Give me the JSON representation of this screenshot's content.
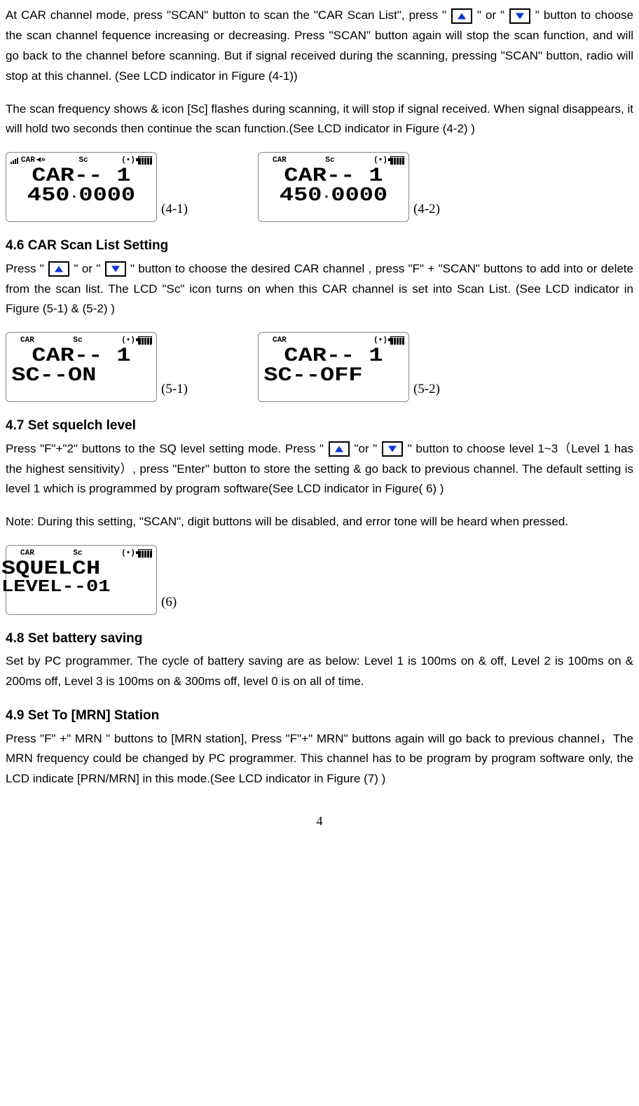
{
  "p1a": "At CAR channel mode, press \"SCAN\" button to scan the \"CAR Scan List\", press \"",
  "p1b": "\" or \"",
  "p1c": "\" button to choose the scan channel fequence increasing or decreasing. Press \"SCAN\" button again will stop the scan function, and will go back to the channel before scanning. But if signal received during the scanning, pressing \"SCAN\" button, radio will stop at this channel. (See LCD indicator in Figure (4-1))",
  "p2": "The scan frequency shows & icon [Sc] flashes during scanning, it will stop if signal received. When signal disappears, it will hold two seconds then continue the scan function.(See LCD indicator in Figure (4-2) )",
  "fig41cap": "(4-1)",
  "fig42cap": "(4-2)",
  "lcd41": {
    "top_left": "CAR",
    "top_mid": "Sc",
    "top_tx": "(•)",
    "line1": "CAR-- 1",
    "line2a": "450",
    "line2b": "0000",
    "sig": true,
    "spk": true
  },
  "lcd42": {
    "top_left": "CAR",
    "top_mid": "Sc",
    "top_tx": "(•)",
    "line1": "CAR-- 1",
    "line2a": "450",
    "line2b": "0000",
    "sig": false,
    "spk": false
  },
  "h46": "4.6 CAR Scan List Setting",
  "p46a": "Press \" ",
  "p46b": " \" or \" ",
  "p46c": " \" button to choose the desired CAR channel , press \"F\" + \"SCAN\" buttons to add into or delete from the scan list. The LCD \"Sc\" icon turns on when this CAR channel is set into Scan List. (See LCD indicator in Figure (5-1) & (5-2) )",
  "fig51cap": "(5-1)",
  "fig52cap": "(5-2)",
  "lcd51": {
    "top_left": "CAR",
    "top_mid": "Sc",
    "top_tx": "(•)",
    "line1": "CAR-- 1",
    "line2": "SC--ON"
  },
  "lcd52": {
    "top_left": "CAR",
    "top_mid": "",
    "top_tx": "(•)",
    "line1": "CAR-- 1",
    "line2": "SC--OFF"
  },
  "h47": "4.7 Set squelch level",
  "p47a": "Press \"F\"+\"2\" buttons to the SQ level setting mode. Press \"",
  "p47b": " \"or \"",
  "p47c": "\" button to choose level 1~3（Level 1 has the highest sensitivity）, press \"Enter\" button to store the setting & go back to previous channel. The default setting is level 1 which is programmed by program software(See LCD indicator in Figure( 6) )",
  "p47note": "Note: During this setting, \"SCAN\", digit buttons will be disabled, and error tone will be heard when pressed.",
  "fig6cap": "(6)",
  "lcd6": {
    "top_left": "CAR",
    "top_mid": "Sc",
    "top_tx": "(•)",
    "line1": "SQUELCH",
    "line2": "LEVEL--01"
  },
  "h48": "4.8 Set battery saving",
  "p48": "Set by PC programmer. The cycle of battery saving are as below: Level 1 is 100ms on & off, Level 2 is 100ms on & 200ms off, Level 3 is 100ms on & 300ms off, level 0 is on all of time.",
  "h49": "4.9 Set To [MRN] Station",
  "p49": "Press \"F\" +\" MRN \" buttons to [MRN station], Press \"F\"+\" MRN\" buttons again will go back to previous channel，The MRN frequency could be changed by PC programmer. This channel has to be program by program software only, the LCD indicate [PRN/MRN] in this mode.(See LCD indicator in Figure (7) )",
  "pagenum": "4"
}
